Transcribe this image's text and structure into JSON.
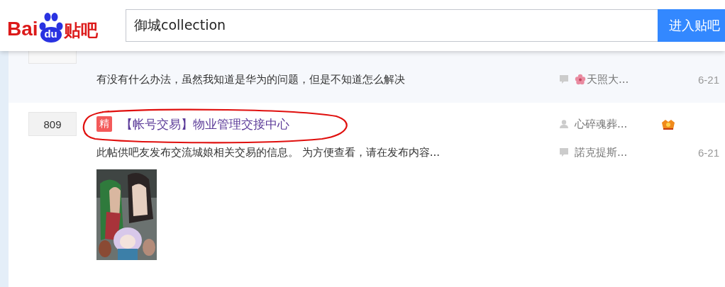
{
  "header": {
    "logo": {
      "word": "Bai",
      "badge": "du",
      "name": "贴吧"
    },
    "search": {
      "value": "御城collection"
    },
    "button": "进入贴吧"
  },
  "threads": [
    {
      "kind": "cut",
      "abstract": "有没有什么办法，虽然我知道是华为的问题，但是不知道怎么解决",
      "last_replier": "天照大...",
      "replier_flower": true,
      "last_reply_time": "6-21"
    },
    {
      "kind": "full",
      "reply_count": "809",
      "badge": "精",
      "title": "【帐号交易】物业管理交接中心",
      "circled": true,
      "author": "心碎魂葬...",
      "author_medal": true,
      "abstract": "此帖供吧友发布交流城娘相关交易的信息。 为方便查看，请在发布内容...",
      "last_replier": "諾克提斯...",
      "replier_flower": false,
      "last_reply_time": "6-21"
    }
  ]
}
